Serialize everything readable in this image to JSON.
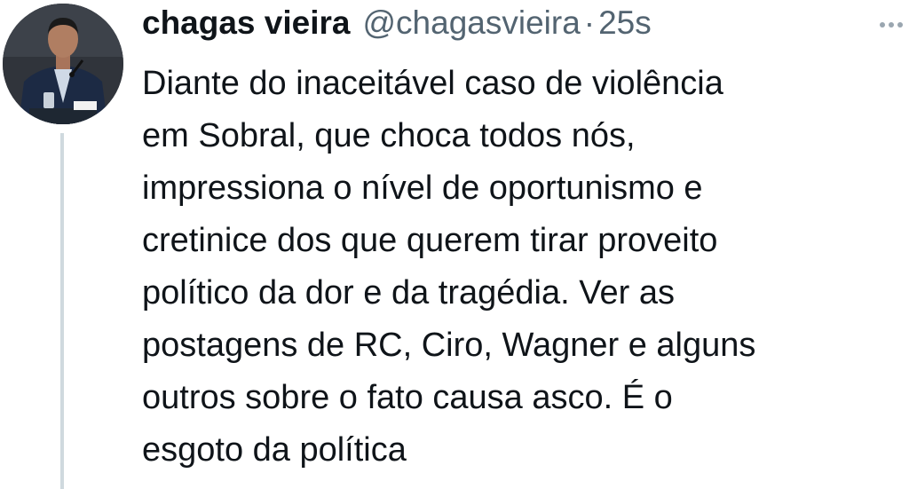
{
  "tweet": {
    "author": {
      "display_name": "chagas vieira",
      "handle": "@chagasvieira",
      "avatar_icon": "profile-photo"
    },
    "separator": "·",
    "timestamp": "25s",
    "more_icon": "more-horizontal-icon",
    "text": "Diante do inaceitável caso de violência\nem Sobral, que choca todos nós,\nimpressiona o nível de oportunismo e\ncretinice dos que querem tirar proveito\npolítico da dor e da tragédia. Ver as\npostagens de RC, Ciro, Wagner e alguns\noutros sobre o fato causa asco. É o\nesgoto da política"
  },
  "colors": {
    "text_primary": "#0f1419",
    "text_secondary": "#536471",
    "thread_line": "#cfd9de",
    "background": "#ffffff"
  }
}
